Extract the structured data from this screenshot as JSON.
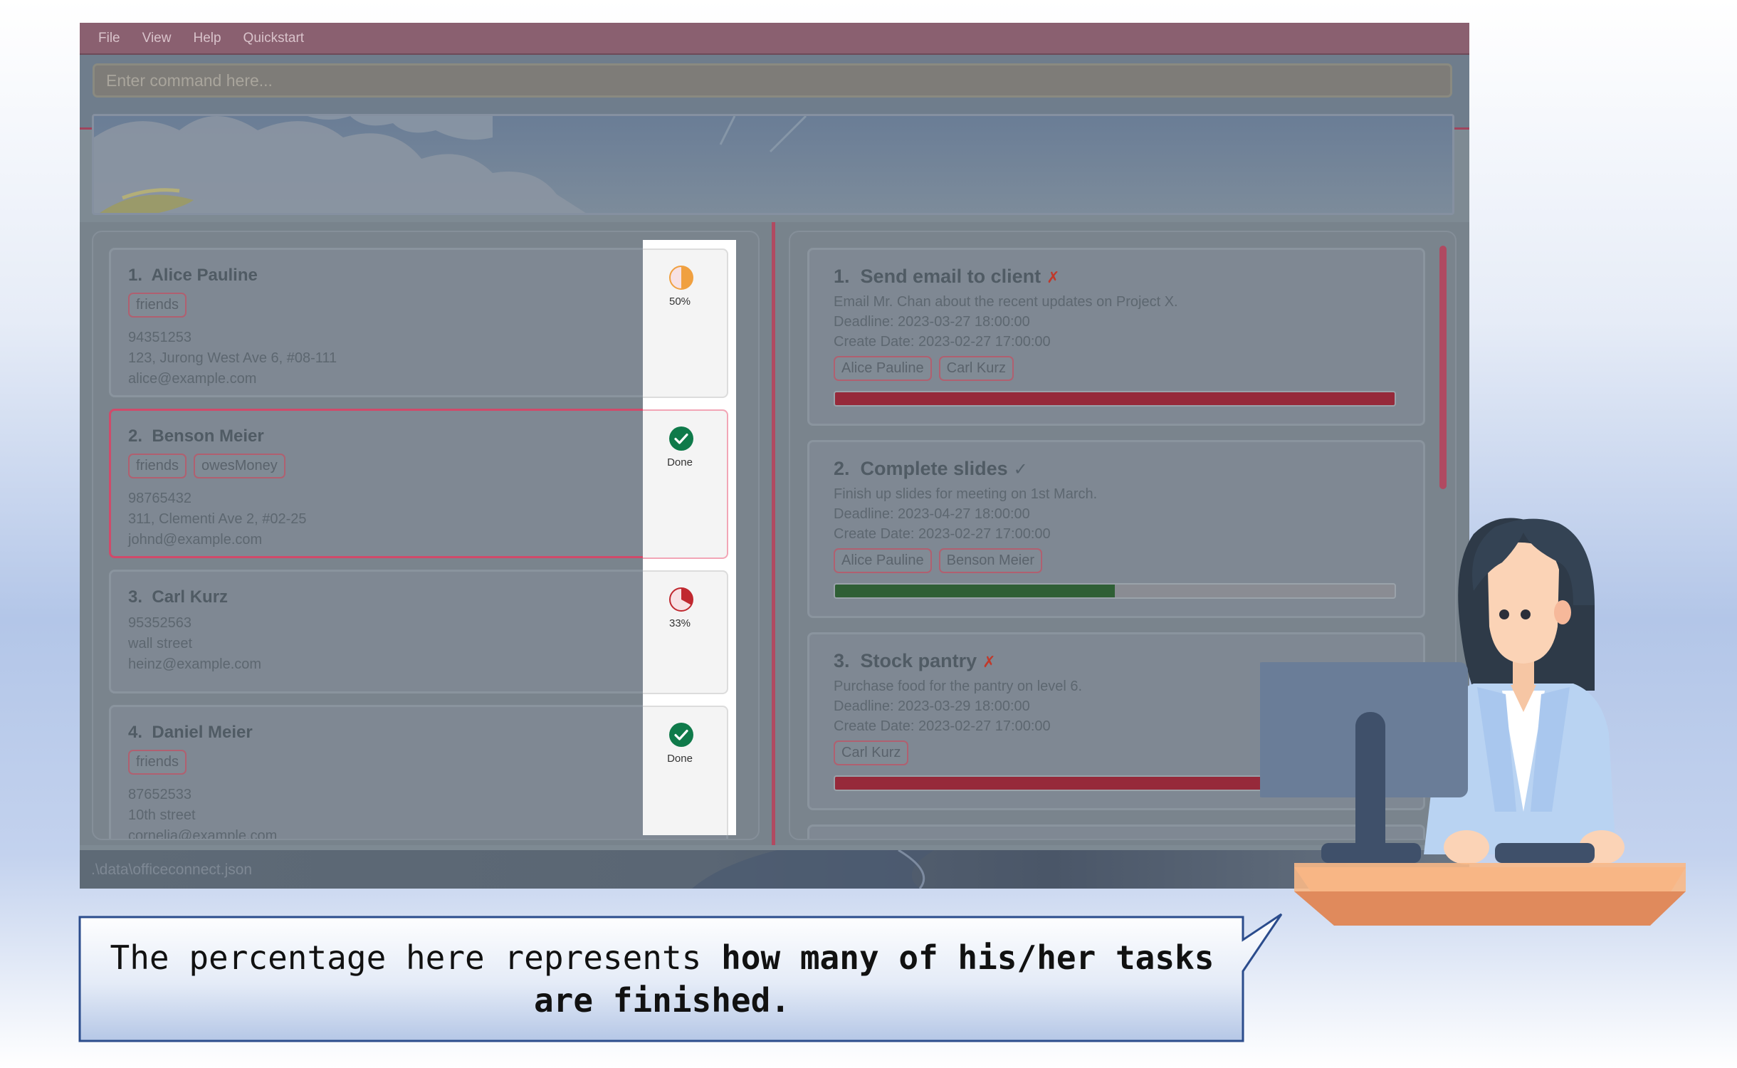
{
  "menu": [
    "File",
    "View",
    "Help",
    "Quickstart"
  ],
  "command": {
    "placeholder": "Enter command here..."
  },
  "persons": [
    {
      "index": "1.",
      "name": "Alice Pauline",
      "tags": [
        "friends"
      ],
      "phone": "94351253",
      "address": "123, Jurong West Ave 6, #08-111",
      "email": "alice@example.com",
      "progress_label": "50%",
      "progress": 0.5
    },
    {
      "index": "2.",
      "name": "Benson Meier",
      "tags": [
        "friends",
        "owesMoney"
      ],
      "phone": "98765432",
      "address": "311, Clementi Ave 2, #02-25",
      "email": "johnd@example.com",
      "progress_label": "Done",
      "progress": 1.0
    },
    {
      "index": "3.",
      "name": "Carl Kurz",
      "tags": [],
      "phone": "95352563",
      "address": "wall street",
      "email": "heinz@example.com",
      "progress_label": "33%",
      "progress": 0.33
    },
    {
      "index": "4.",
      "name": "Daniel Meier",
      "tags": [
        "friends"
      ],
      "phone": "87652533",
      "address": "10th street",
      "email": "cornelia@example.com",
      "progress_label": "Done",
      "progress": 1.0
    }
  ],
  "tasks": [
    {
      "index": "1.",
      "title": "Send email to client",
      "status_mark": "✗",
      "description": "Email Mr. Chan about the recent updates on Project X.",
      "deadline": "Deadline: 2023-03-27 18:00:00",
      "created": "Create Date: 2023-02-27 17:00:00",
      "assignees": [
        "Alice Pauline",
        "Carl Kurz"
      ],
      "progress": 1.0,
      "bar_color": "#96293a"
    },
    {
      "index": "2.",
      "title": "Complete slides",
      "status_mark": "✓",
      "description": "Finish up slides for meeting on 1st March.",
      "deadline": "Deadline: 2023-04-27 18:00:00",
      "created": "Create Date: 2023-02-27 17:00:00",
      "assignees": [
        "Alice Pauline",
        "Benson Meier"
      ],
      "progress": 0.5,
      "bar_color": "#2f5f35"
    },
    {
      "index": "3.",
      "title": "Stock pantry",
      "status_mark": "✗",
      "description": "Purchase food for the pantry on level 6.",
      "deadline": "Deadline: 2023-03-29 18:00:00",
      "created": "Create Date: 2023-02-27 17:00:00",
      "assignees": [
        "Carl Kurz"
      ],
      "progress": 1.0,
      "bar_color": "#96293a"
    }
  ],
  "status_bar": {
    "path": ".\\data\\officeconnect.json"
  },
  "callout": {
    "text_plain": "The percentage here represents ",
    "text_bold_1": "how many of his/her tasks",
    "text_bold_2": "are finished."
  },
  "colors": {
    "accent": "#b14a61",
    "progress_half": "#f0a040",
    "progress_third": "#c0282f",
    "done_green": "#0f7a4a"
  }
}
